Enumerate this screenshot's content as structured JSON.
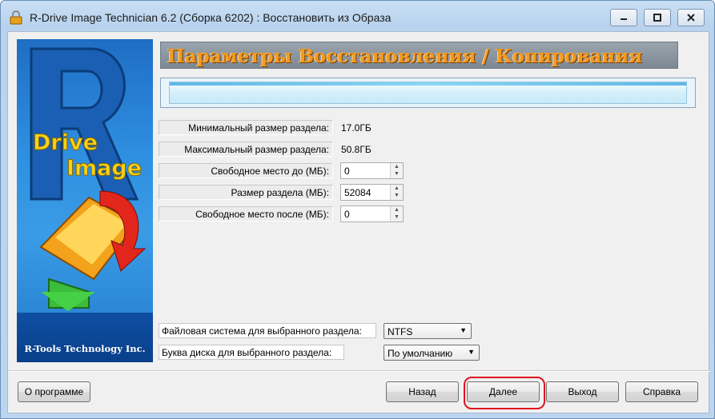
{
  "window": {
    "title": "R-Drive Image Technician 6.2 (Сборка 6202) : Восстановить из Образа"
  },
  "banner": {
    "company": "R-Tools Technology Inc."
  },
  "header": {
    "title": "Параметры Восстановления / Копирования"
  },
  "params": {
    "min_size_label": "Минимальный размер раздела:",
    "min_size_value": "17.0ГБ",
    "max_size_label": "Максимальный размер раздела:",
    "max_size_value": "50.8ГБ",
    "free_before_label": "Свободное место до (МБ):",
    "free_before_value": "0",
    "partition_size_label": "Размер раздела (МБ):",
    "partition_size_value": "52084",
    "free_after_label": "Свободное место после (МБ):",
    "free_after_value": "0"
  },
  "options": {
    "fs_label": "Файловая система для выбранного раздела:",
    "fs_value": "NTFS",
    "letter_label": "Буква диска для выбранного раздела:",
    "letter_value": "По умолчанию"
  },
  "buttons": {
    "about": "О программе",
    "back": "Назад",
    "next": "Далее",
    "exit": "Выход",
    "help": "Справка"
  }
}
